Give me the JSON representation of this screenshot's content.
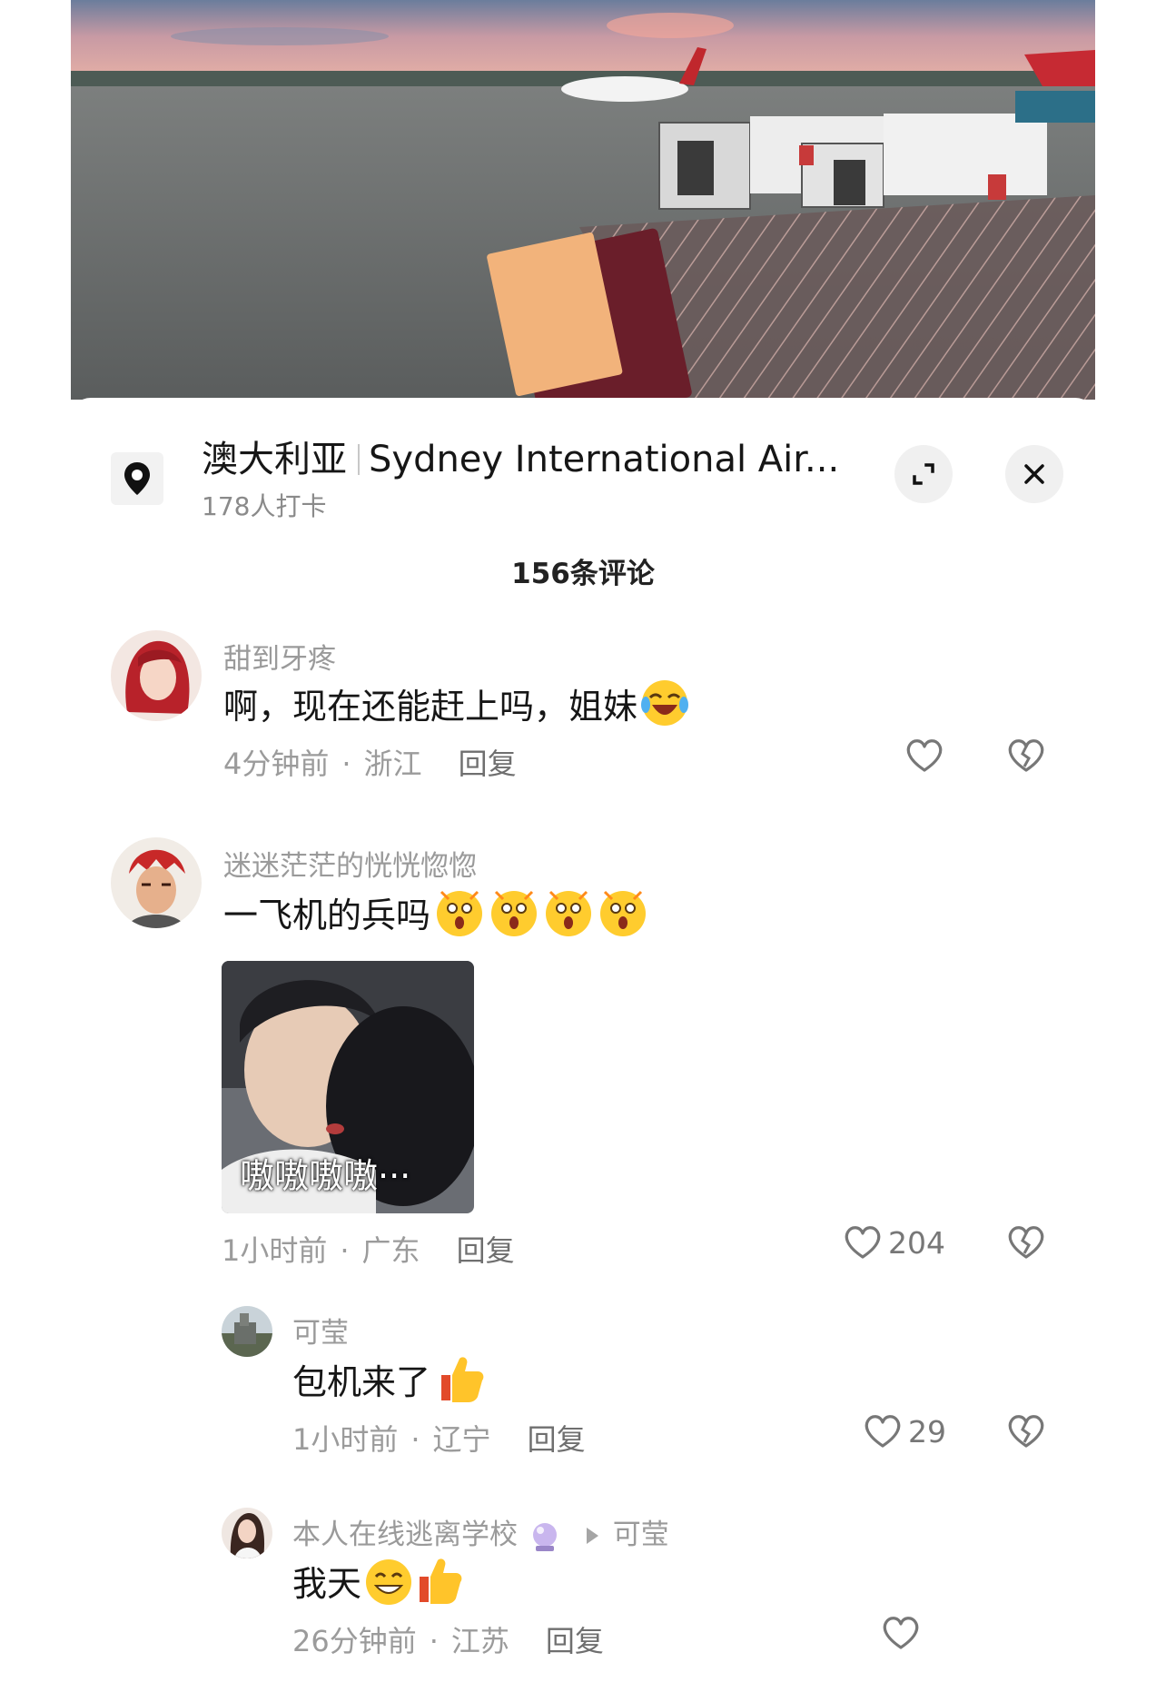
{
  "location": {
    "title": "澳大利亚",
    "title_rest": "Sydney International Air...",
    "checkins": "178人打卡"
  },
  "comments_header": "156条评论",
  "colors": {
    "accent_like": "#777777",
    "muted": "#9b9b9b"
  },
  "icons": {
    "location": "map-pin-icon",
    "expand": "expand-icon",
    "close": "close-icon",
    "like": "heart-outline-icon",
    "dislike": "broken-heart-icon"
  },
  "comments": [
    {
      "user": "甜到牙疼",
      "text": "啊，现在还能赶上吗，姐妹",
      "emojis": [
        "laughing-crying-emoji"
      ],
      "time": "4分钟前",
      "region": "浙江",
      "reply_label": "回复",
      "likes": ""
    },
    {
      "user": "迷迷茫茫的恍恍惚惚",
      "text": "一飞机的兵吗",
      "emojis": [
        "shocked-emoji",
        "shocked-emoji",
        "shocked-emoji",
        "shocked-emoji"
      ],
      "sticker_caption": "嗷嗷嗷嗷···",
      "time": "1小时前",
      "region": "广东",
      "reply_label": "回复",
      "likes": "204"
    }
  ],
  "replies": [
    {
      "user": "可莹",
      "text": "包机来了",
      "emojis": [
        "thumbs-up-emoji"
      ],
      "time": "1小时前",
      "region": "辽宁",
      "reply_label": "回复",
      "likes": "29"
    },
    {
      "user": "本人在线逃离学校",
      "reply_to": "可莹",
      "text": "我天",
      "emojis": [
        "grinning-emoji",
        "thumbs-up-emoji"
      ],
      "time": "26分钟前",
      "region": "江苏",
      "reply_label": "回复",
      "likes": ""
    }
  ]
}
